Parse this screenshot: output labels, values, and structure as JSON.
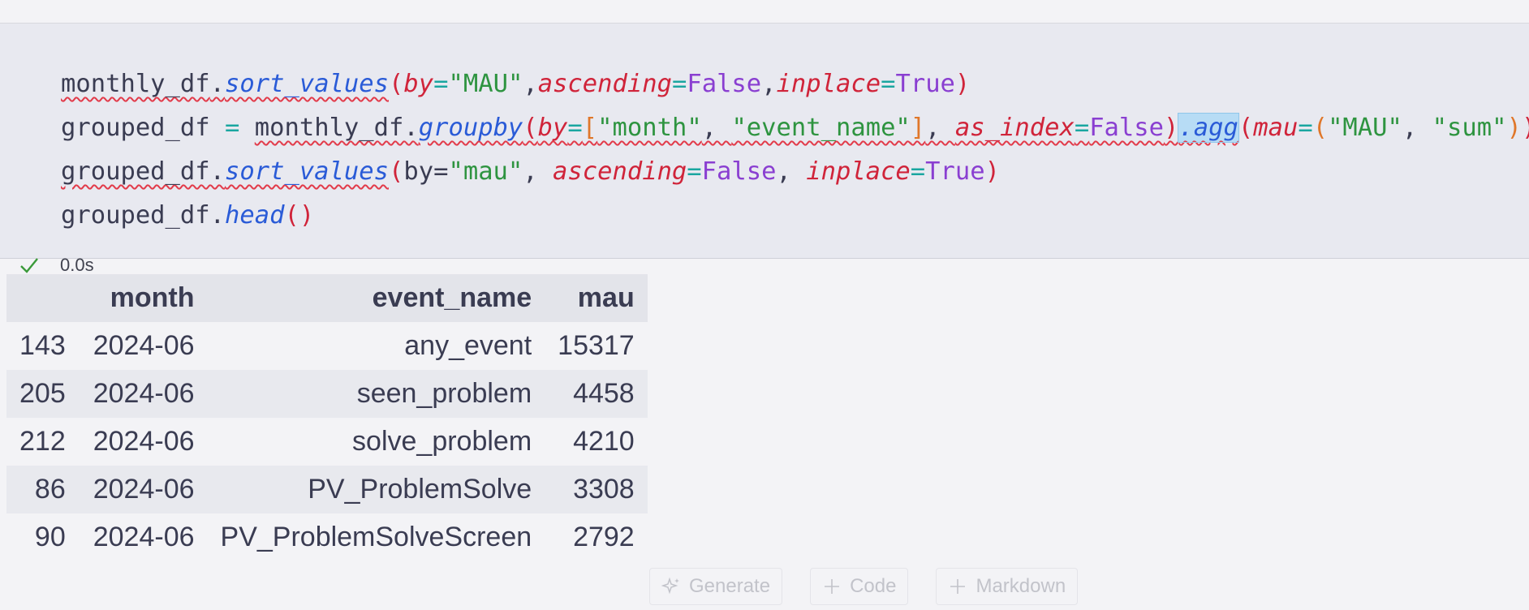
{
  "code_lines": [
    [
      {
        "t": "monthly_df",
        "c": "sq"
      },
      {
        "t": ".",
        "c": "sq"
      },
      {
        "t": "sort_values",
        "c": "fn sq"
      },
      {
        "t": "(",
        "c": "par"
      },
      {
        "t": "by",
        "c": "kw"
      },
      {
        "t": "=",
        "c": "op"
      },
      {
        "t": "\"MAU\"",
        "c": "str"
      },
      {
        "t": ",",
        "c": ""
      },
      {
        "t": "ascending",
        "c": "kw"
      },
      {
        "t": "=",
        "c": "op"
      },
      {
        "t": "False",
        "c": "const"
      },
      {
        "t": ",",
        "c": ""
      },
      {
        "t": "inplace",
        "c": "kw"
      },
      {
        "t": "=",
        "c": "op"
      },
      {
        "t": "True",
        "c": "const"
      },
      {
        "t": ")",
        "c": "par"
      }
    ],
    [
      {
        "t": "grouped_df ",
        "c": ""
      },
      {
        "t": "=",
        "c": "op"
      },
      {
        "t": " ",
        "c": ""
      },
      {
        "t": "monthly_df.",
        "c": "sq"
      },
      {
        "t": "groupby",
        "c": "fn sq"
      },
      {
        "t": "(",
        "c": "par sq"
      },
      {
        "t": "by",
        "c": "kw sq"
      },
      {
        "t": "=",
        "c": "op sq"
      },
      {
        "t": "[",
        "c": "brk sq"
      },
      {
        "t": "\"month\"",
        "c": "str sq"
      },
      {
        "t": ", ",
        "c": "sq"
      },
      {
        "t": "\"event_name\"",
        "c": "str sq"
      },
      {
        "t": "]",
        "c": "brk sq"
      },
      {
        "t": ", ",
        "c": "sq"
      },
      {
        "t": "as_index",
        "c": "kw sq"
      },
      {
        "t": "=",
        "c": "op sq"
      },
      {
        "t": "False",
        "c": "const sq"
      },
      {
        "t": ")",
        "c": "par sq"
      },
      {
        "t": ".agg",
        "c": "fn sel sq"
      },
      {
        "t": "(",
        "c": "par"
      },
      {
        "t": "mau",
        "c": "kw"
      },
      {
        "t": "=",
        "c": "op"
      },
      {
        "t": "(",
        "c": "brk"
      },
      {
        "t": "\"MAU\"",
        "c": "str"
      },
      {
        "t": ", ",
        "c": ""
      },
      {
        "t": "\"sum\"",
        "c": "str"
      },
      {
        "t": ")",
        "c": "brk"
      },
      {
        "t": ")",
        "c": "par"
      }
    ],
    [
      {
        "t": "grouped_df.",
        "c": "sq"
      },
      {
        "t": "sort_values",
        "c": "fn sq"
      },
      {
        "t": "(",
        "c": "par"
      },
      {
        "t": "by=",
        "c": ""
      },
      {
        "t": "\"mau\"",
        "c": "str"
      },
      {
        "t": ", ",
        "c": ""
      },
      {
        "t": "ascending",
        "c": "kw"
      },
      {
        "t": "=",
        "c": "op"
      },
      {
        "t": "False",
        "c": "const"
      },
      {
        "t": ", ",
        "c": ""
      },
      {
        "t": "inplace",
        "c": "kw"
      },
      {
        "t": "=",
        "c": "op"
      },
      {
        "t": "True",
        "c": "const"
      },
      {
        "t": ")",
        "c": "par"
      }
    ],
    [
      {
        "t": "grouped_df.",
        "c": ""
      },
      {
        "t": "head",
        "c": "fn"
      },
      {
        "t": "()",
        "c": "par"
      }
    ]
  ],
  "status": {
    "icon": "check-icon",
    "time": "0.0s",
    "color": "#3a9a3a"
  },
  "output_table": {
    "headers": [
      "",
      "month",
      "event_name",
      "mau"
    ],
    "rows": [
      [
        "143",
        "2024-06",
        "any_event",
        "15317"
      ],
      [
        "205",
        "2024-06",
        "seen_problem",
        "4458"
      ],
      [
        "212",
        "2024-06",
        "solve_problem",
        "4210"
      ],
      [
        "86",
        "2024-06",
        "PV_ProblemSolve",
        "3308"
      ],
      [
        "90",
        "2024-06",
        "PV_ProblemSolveScreen",
        "2792"
      ]
    ]
  },
  "toolbar": {
    "generate_label": "Generate",
    "code_label": "Code",
    "markdown_label": "Markdown"
  }
}
